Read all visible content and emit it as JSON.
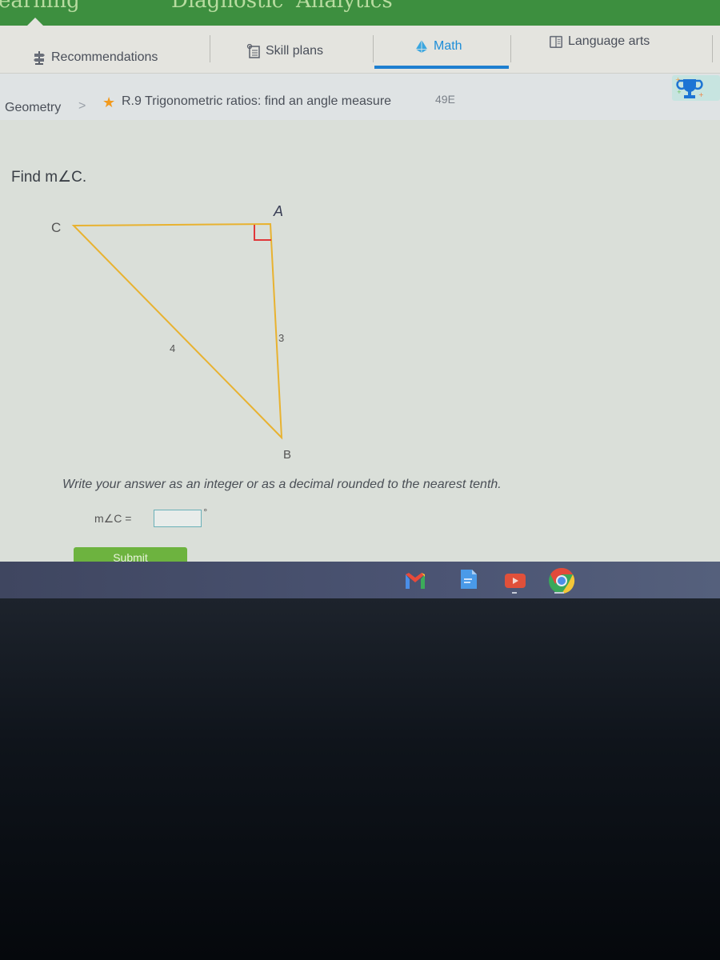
{
  "top_nav": {
    "items": [
      "earning",
      "Diagnostic",
      "Analytics"
    ]
  },
  "subject_tabs": [
    {
      "label": "Recommendations",
      "icon": "signpost-icon",
      "active": false
    },
    {
      "label": "Skill plans",
      "icon": "skill-plan-icon",
      "active": false
    },
    {
      "label": "Math",
      "icon": "pyramid-icon",
      "active": true
    },
    {
      "label": "Language arts",
      "icon": "book-icon",
      "active": false
    }
  ],
  "breadcrumb": {
    "parent": "Geometry",
    "separator": ">",
    "skill": "R.9 Trigonometric ratios: find an angle measure",
    "skill_code": "49E",
    "trophy_icon": "trophy-icon"
  },
  "question": {
    "prompt": "Find m∠C.",
    "diagram": {
      "vertices": {
        "A": "A",
        "B": "B",
        "C": "C"
      },
      "right_angle_at": "A",
      "side_labels": {
        "CB": "4",
        "AB": "3"
      }
    },
    "instructions": "Write your answer as an integer or as a decimal rounded to the nearest tenth.",
    "answer_label": "m∠C =",
    "answer_value": "",
    "answer_unit": "°",
    "submit_label": "Submit"
  },
  "shelf": {
    "apps": [
      "Gmail",
      "Docs",
      "YouTube",
      "Chrome"
    ]
  },
  "colors": {
    "accent": "#1e8ed8",
    "nav_green": "#3d8f3f",
    "submit_green": "#6db33f",
    "triangle": "#e8b230",
    "right_angle": "#e0383a"
  }
}
